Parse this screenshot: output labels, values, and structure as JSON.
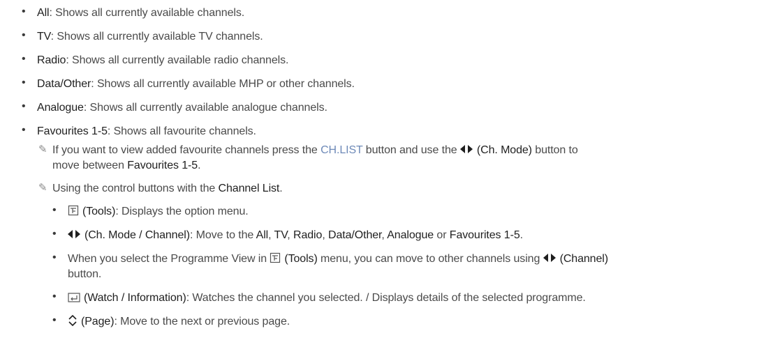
{
  "bullets": [
    {
      "term": "All",
      "desc": ": Shows all currently available channels."
    },
    {
      "term": "TV",
      "desc": ": Shows all currently available TV channels."
    },
    {
      "term": "Radio",
      "desc": ": Shows all currently available radio channels."
    },
    {
      "term": "Data/Other",
      "desc": ": Shows all currently available MHP or other channels."
    },
    {
      "term": "Analogue",
      "desc": ": Shows all currently available analogue channels."
    },
    {
      "term": "Favourites 1-5",
      "desc": ": Shows all favourite channels."
    }
  ],
  "note1": {
    "p1": "If you want to view added favourite channels press the ",
    "key": "CH.LIST",
    "p2": " button and use the ",
    "p3": "(Ch. Mode)",
    "p4": " button to",
    "line2a": "move between ",
    "line2b": "Favourites 1-5",
    "line2c": "."
  },
  "note2": {
    "p1": "Using the control buttons with the ",
    "p2": "Channel List",
    "p3": "."
  },
  "sub": {
    "tools_label": "(Tools)",
    "tools_desc": ": Displays the option menu.",
    "chmode_label": "(Ch. Mode / Channel)",
    "chmode_desc1": ": Move to the ",
    "chmode_all": "All",
    "comma1": ", ",
    "chmode_tv": "TV",
    "comma2": ", ",
    "chmode_radio": "Radio",
    "comma3": ", ",
    "chmode_data": "Data/Other",
    "comma4": ", ",
    "chmode_analogue": "Analogue",
    "chmode_or": " or ",
    "chmode_fav": "Favourites 1-5",
    "chmode_end": ".",
    "prog_a": "When you select the Programme View in ",
    "prog_tools": "(Tools)",
    "prog_b": " menu, you can move to other channels using ",
    "prog_channel": "(Channel)",
    "prog_c": "button.",
    "watch_label": "(Watch / Information)",
    "watch_desc": ": Watches the channel you selected. / Displays details of the selected programme.",
    "page_label": "(Page)",
    "page_desc": ": Move to the next or previous page."
  },
  "icons": [
    "bullet-icon",
    "pencil-note-icon",
    "tools-icon",
    "left-right-arrow-icon",
    "enter-icon",
    "up-down-chevron-icon"
  ]
}
